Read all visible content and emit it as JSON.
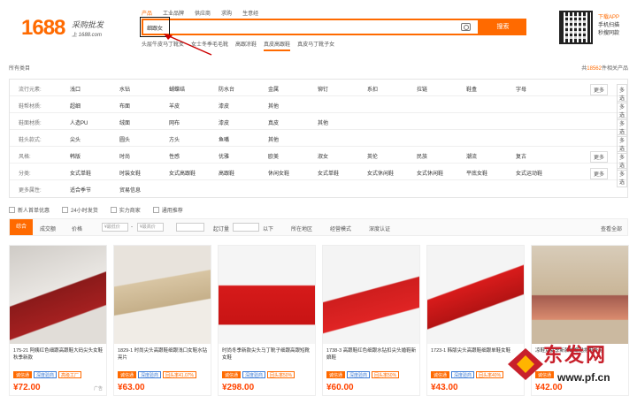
{
  "header": {
    "logo_number": "1688",
    "logo_slogan": "采购批发",
    "logo_url": "上 1688.com",
    "search_tabs": [
      {
        "label": "产品",
        "active": true
      },
      {
        "label": "工业品牌",
        "active": false
      },
      {
        "label": "供应商",
        "active": false
      },
      {
        "label": "求购",
        "active": false
      },
      {
        "label": "生意经",
        "active": false
      }
    ],
    "search_value": "细跟女",
    "search_button": "搜索",
    "hot_words": [
      {
        "label": "头层牛皮马丁靴女",
        "active": false
      },
      {
        "label": "女士冬季毛毛靴",
        "active": false
      },
      {
        "label": "高跟凉鞋",
        "active": false
      },
      {
        "label": "真皮高跟鞋",
        "active": true
      },
      {
        "label": "真皮马丁靴子女",
        "active": false
      }
    ],
    "app": {
      "title": "下载APP",
      "line1": "手机扫描",
      "line2": "秒搜同款"
    }
  },
  "breadcrumb": "所有类目",
  "result_count": {
    "prefix": "共",
    "number": "18562",
    "suffix": "件相关产品"
  },
  "filters": [
    {
      "label": "流行元素:",
      "options": [
        "浅口",
        "水钻",
        "蝴蝶结",
        "防水台",
        "金属",
        "铆钉",
        "系扣",
        "拉链",
        "鞋盒",
        "字母"
      ],
      "more": "更多",
      "multi": "多选"
    },
    {
      "label": "鞋帮材质:",
      "options": [
        "超细",
        "布面",
        "羊皮",
        "漆皮",
        "其他"
      ],
      "more": "",
      "multi": "多选"
    },
    {
      "label": "鞋面材质:",
      "options": [
        "人造PU",
        "绒面",
        "网布",
        "漆皮",
        "真皮",
        "其他"
      ],
      "more": "",
      "multi": "多选"
    },
    {
      "label": "鞋头款式:",
      "options": [
        "尖头",
        "圆头",
        "方头",
        "鱼嘴",
        "其他"
      ],
      "more": "",
      "multi": "多选"
    },
    {
      "label": "风格:",
      "options": [
        "韩版",
        "时尚",
        "性感",
        "优雅",
        "欧美",
        "淑女",
        "英伦",
        "民族",
        "潮流",
        "复古"
      ],
      "more": "更多",
      "multi": "多选"
    },
    {
      "label": "分类:",
      "options": [
        "女式单鞋",
        "时装女鞋",
        "女式高跟鞋",
        "高跟鞋",
        "休闲女鞋",
        "女式单鞋",
        "女式休闲鞋",
        "女式休闲鞋",
        "平底女鞋",
        "女式运动鞋"
      ],
      "more": "更多",
      "multi": "多选"
    },
    {
      "label": "更多属性:",
      "options": [
        "适合季节",
        "贸易信息"
      ],
      "more": "",
      "multi": ""
    }
  ],
  "checkboxes": [
    "新人首单优惠",
    "24小时发货",
    "实力商家",
    "通用推荐"
  ],
  "sortbar": {
    "active": "综合",
    "items": [
      "成交额",
      "价格"
    ],
    "price_from": "¥最低价",
    "price_to": "¥最高价",
    "qty_label": "起订量",
    "qty_unit": "以下",
    "right_items": [
      "所在地区",
      "经营模式",
      "深度认证"
    ],
    "right_end": "查看全部"
  },
  "products": [
    {
      "title": "175-21 阿姨红色细跟高跟鞋大码尖头女鞋秋季新款",
      "tags": [
        "诚信通",
        "深度验商",
        "高级工厂"
      ],
      "price": "¥72.00",
      "extra": "广告"
    },
    {
      "title": "1829-1 时尚尖头高跟鞋细跟浅口女鞋水钻亮片",
      "tags": [
        "诚信通",
        "深度验商",
        "回头率41.07%"
      ],
      "price": "¥63.00",
      "extra": ""
    },
    {
      "title": "时尚冬季新款尖头马丁靴子细跟高跟短靴女鞋",
      "tags": [
        "诚信通",
        "深度验商",
        "回头率50%"
      ],
      "price": "¥298.00",
      "extra": ""
    },
    {
      "title": "1738-3 高跟鞋红色细跟水钻扣尖头婚鞋新娘鞋",
      "tags": [
        "诚信通",
        "深度验商",
        "回头率50%"
      ],
      "price": "¥60.00",
      "extra": ""
    },
    {
      "title": "1723-1 韩版尖头高跟鞋细跟单鞋女鞋",
      "tags": [
        "诚信通",
        "深度验商",
        "回头率40%"
      ],
      "price": "¥43.00",
      "extra": ""
    },
    {
      "title": "凉鞋女夏季新款蝴蝶结拖鞋外穿",
      "tags": [
        "诚信通"
      ],
      "price": "¥42.00",
      "extra": ""
    }
  ],
  "watermark": {
    "text": "东发网",
    "url": "www.pf.cn"
  },
  "colors": {
    "accent": "#ff6a00",
    "price": "#ff4400"
  }
}
